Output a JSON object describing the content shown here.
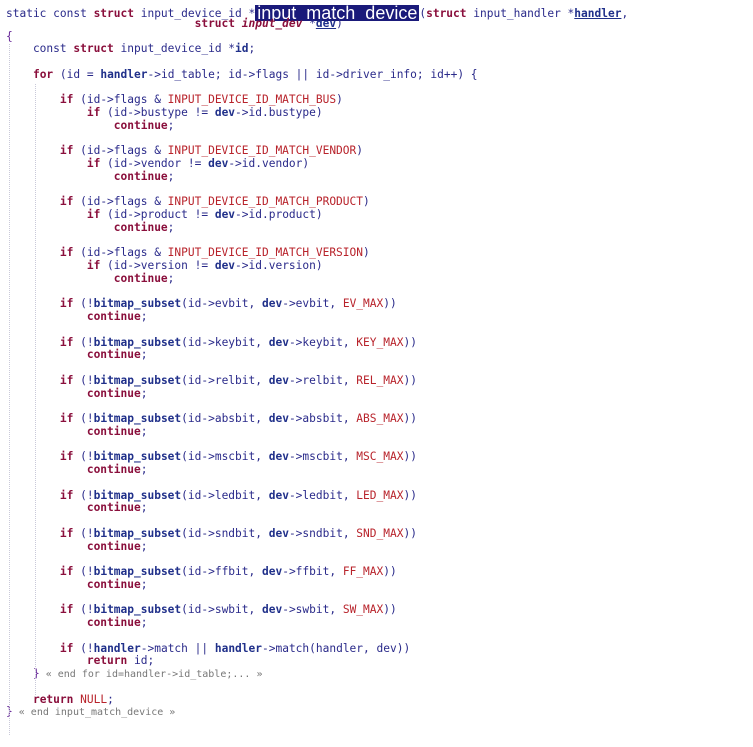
{
  "colors": {
    "keyword": "#8a0f3c",
    "macro": "#b8232b",
    "identifier": "#20308a",
    "highlight_bg": "#1a1a7a",
    "comment": "#777777"
  },
  "code": {
    "line1": {
      "prefix": "static const ",
      "struct": "struct",
      "type": " input_device_id *",
      "func_name": "input_match_device",
      "open": "(",
      "struct2": "struct",
      "type2": " input_handler *",
      "param1": "handler",
      "comma": ","
    },
    "line2": {
      "indent": "                            ",
      "struct": "struct",
      "type": " input_dev",
      "star": " *",
      "param2": "dev",
      "close": ")"
    },
    "open_brace": "{",
    "decl": {
      "pre": "const ",
      "struct": "struct",
      "type": " input_device_id *",
      "var": "id",
      "semi": ";"
    },
    "for_line": {
      "kw": "for",
      "a": " (id = ",
      "handler": "handler",
      "b": "->id_table; id->flags || id->driver_info; id++) {"
    },
    "match_blocks": [
      {
        "flag": "INPUT_DEVICE_ID_MATCH_BUS",
        "field": "bustype"
      },
      {
        "flag": "INPUT_DEVICE_ID_MATCH_VENDOR",
        "field": "vendor"
      },
      {
        "flag": "INPUT_DEVICE_ID_MATCH_PRODUCT",
        "field": "product"
      },
      {
        "flag": "INPUT_DEVICE_ID_MATCH_VERSION",
        "field": "version"
      }
    ],
    "bitmap_blocks": [
      {
        "a": "id->evbit",
        "b": "evbit",
        "max": "EV_MAX"
      },
      {
        "a": "id->keybit",
        "b": "keybit",
        "max": "KEY_MAX"
      },
      {
        "a": "id->relbit",
        "b": "relbit",
        "max": "REL_MAX"
      },
      {
        "a": "id->absbit",
        "b": "absbit",
        "max": "ABS_MAX"
      },
      {
        "a": "id->mscbit",
        "b": "mscbit",
        "max": "MSC_MAX"
      },
      {
        "a": "id->ledbit",
        "b": "ledbit",
        "max": "LED_MAX"
      },
      {
        "a": "id->sndbit",
        "b": "sndbit",
        "max": "SND_MAX"
      },
      {
        "a": "id->ffbit",
        "b": "ffbit",
        "max": "FF_MAX"
      },
      {
        "a": "id->swbit",
        "b": "swbit",
        "max": "SW_MAX"
      }
    ],
    "kw_if": "if",
    "kw_continue": "continue",
    "kw_return": "return",
    "bitmap_fn": "bitmap_subset",
    "dev": "dev",
    "handler_match": {
      "a": " (!",
      "handler1": "handler",
      "b": "->match || ",
      "handler2": "handler",
      "c": "->match(handler, dev))"
    },
    "return_id": " id;",
    "end_for_brace": "}",
    "end_for_comment": " « end for id=handler->id_table;... »",
    "return_null_kw": "return",
    "return_null_val": " NULL",
    "return_null_semi": ";",
    "end_func_brace": "}",
    "end_func_comment": " « end input_match_device »"
  }
}
